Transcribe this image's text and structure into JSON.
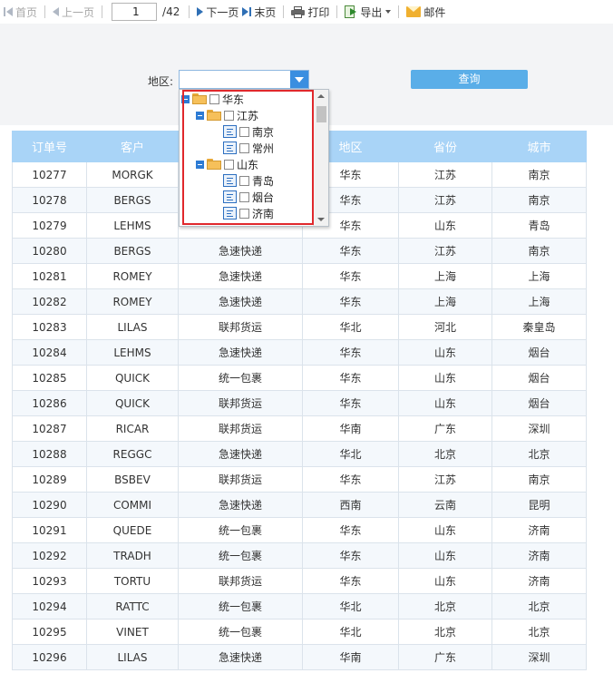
{
  "toolbar": {
    "first": "首页",
    "prev": "上一页",
    "page_value": "1",
    "page_total": "/42",
    "next": "下一页",
    "last": "末页",
    "print": "打印",
    "export": "导出",
    "mail": "邮件"
  },
  "query": {
    "region_label": "地区:",
    "region_value": "",
    "query_button": "查询"
  },
  "tree": {
    "nodes": [
      {
        "label": "华东",
        "level": 0,
        "type": "folder"
      },
      {
        "label": "江苏",
        "level": 1,
        "type": "folder"
      },
      {
        "label": "南京",
        "level": 2,
        "type": "leaf"
      },
      {
        "label": "常州",
        "level": 2,
        "type": "leaf"
      },
      {
        "label": "山东",
        "level": 1,
        "type": "folder"
      },
      {
        "label": "青岛",
        "level": 2,
        "type": "leaf"
      },
      {
        "label": "烟台",
        "level": 2,
        "type": "leaf"
      },
      {
        "label": "济南",
        "level": 2,
        "type": "leaf"
      }
    ]
  },
  "table": {
    "headers": [
      "订单号",
      "客户",
      "",
      "地区",
      "省份",
      "城市"
    ],
    "rows": [
      [
        "10277",
        "MORGK",
        "",
        "华东",
        "江苏",
        "南京"
      ],
      [
        "10278",
        "BERGS",
        "",
        "华东",
        "江苏",
        "南京"
      ],
      [
        "10279",
        "LEHMS",
        "",
        "华东",
        "山东",
        "青岛"
      ],
      [
        "10280",
        "BERGS",
        "急速快递",
        "华东",
        "江苏",
        "南京"
      ],
      [
        "10281",
        "ROMEY",
        "急速快递",
        "华东",
        "上海",
        "上海"
      ],
      [
        "10282",
        "ROMEY",
        "急速快递",
        "华东",
        "上海",
        "上海"
      ],
      [
        "10283",
        "LILAS",
        "联邦货运",
        "华北",
        "河北",
        "秦皇岛"
      ],
      [
        "10284",
        "LEHMS",
        "急速快递",
        "华东",
        "山东",
        "烟台"
      ],
      [
        "10285",
        "QUICK",
        "统一包裹",
        "华东",
        "山东",
        "烟台"
      ],
      [
        "10286",
        "QUICK",
        "联邦货运",
        "华东",
        "山东",
        "烟台"
      ],
      [
        "10287",
        "RICAR",
        "联邦货运",
        "华南",
        "广东",
        "深圳"
      ],
      [
        "10288",
        "REGGC",
        "急速快递",
        "华北",
        "北京",
        "北京"
      ],
      [
        "10289",
        "BSBEV",
        "联邦货运",
        "华东",
        "江苏",
        "南京"
      ],
      [
        "10290",
        "COMMI",
        "急速快递",
        "西南",
        "云南",
        "昆明"
      ],
      [
        "10291",
        "QUEDE",
        "统一包裹",
        "华东",
        "山东",
        "济南"
      ],
      [
        "10292",
        "TRADH",
        "统一包裹",
        "华东",
        "山东",
        "济南"
      ],
      [
        "10293",
        "TORTU",
        "联邦货运",
        "华东",
        "山东",
        "济南"
      ],
      [
        "10294",
        "RATTC",
        "统一包裹",
        "华北",
        "北京",
        "北京"
      ],
      [
        "10295",
        "VINET",
        "统一包裹",
        "华北",
        "北京",
        "北京"
      ],
      [
        "10296",
        "LILAS",
        "急速快递",
        "华南",
        "广东",
        "深圳"
      ]
    ]
  }
}
